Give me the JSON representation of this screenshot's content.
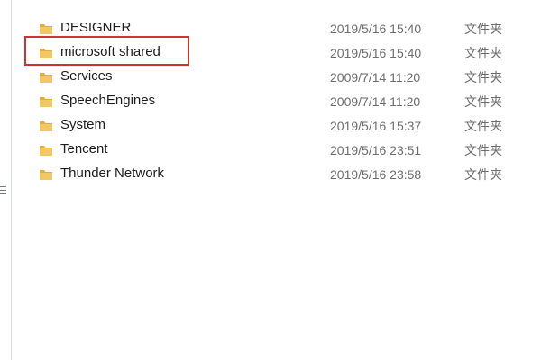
{
  "files": [
    {
      "name": "DESIGNER",
      "date": "2019/5/16 15:40",
      "type": "文件夹",
      "icon": "folder-icon"
    },
    {
      "name": "microsoft shared",
      "date": "2019/5/16 15:40",
      "type": "文件夹",
      "icon": "folder-icon"
    },
    {
      "name": "Services",
      "date": "2009/7/14 11:20",
      "type": "文件夹",
      "icon": "folder-icon"
    },
    {
      "name": "SpeechEngines",
      "date": "2009/7/14 11:20",
      "type": "文件夹",
      "icon": "folder-icon"
    },
    {
      "name": "System",
      "date": "2019/5/16 15:37",
      "type": "文件夹",
      "icon": "folder-icon"
    },
    {
      "name": "Tencent",
      "date": "2019/5/16 23:51",
      "type": "文件夹",
      "icon": "folder-icon"
    },
    {
      "name": "Thunder Network",
      "date": "2019/5/16 23:58",
      "type": "文件夹",
      "icon": "folder-icon"
    }
  ],
  "highlight": {
    "target": "microsoft shared",
    "color": "#c9362f"
  },
  "colors": {
    "folder_fill": "#f2c866",
    "folder_back": "#e4ad3d",
    "name_text": "#1e1e1e",
    "meta_text": "#6d6d6d"
  }
}
